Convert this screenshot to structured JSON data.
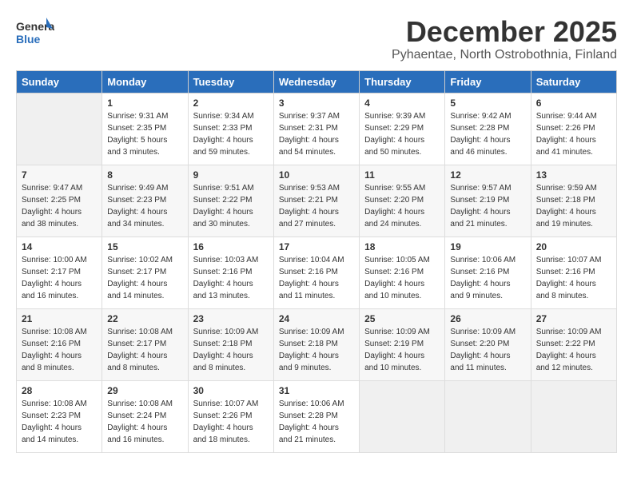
{
  "header": {
    "logo_general": "General",
    "logo_blue": "Blue",
    "month_title": "December 2025",
    "location": "Pyhaentae, North Ostrobothnia, Finland"
  },
  "days_of_week": [
    "Sunday",
    "Monday",
    "Tuesday",
    "Wednesday",
    "Thursday",
    "Friday",
    "Saturday"
  ],
  "weeks": [
    [
      {
        "day": "",
        "info": ""
      },
      {
        "day": "1",
        "info": "Sunrise: 9:31 AM\nSunset: 2:35 PM\nDaylight: 5 hours\nand 3 minutes."
      },
      {
        "day": "2",
        "info": "Sunrise: 9:34 AM\nSunset: 2:33 PM\nDaylight: 4 hours\nand 59 minutes."
      },
      {
        "day": "3",
        "info": "Sunrise: 9:37 AM\nSunset: 2:31 PM\nDaylight: 4 hours\nand 54 minutes."
      },
      {
        "day": "4",
        "info": "Sunrise: 9:39 AM\nSunset: 2:29 PM\nDaylight: 4 hours\nand 50 minutes."
      },
      {
        "day": "5",
        "info": "Sunrise: 9:42 AM\nSunset: 2:28 PM\nDaylight: 4 hours\nand 46 minutes."
      },
      {
        "day": "6",
        "info": "Sunrise: 9:44 AM\nSunset: 2:26 PM\nDaylight: 4 hours\nand 41 minutes."
      }
    ],
    [
      {
        "day": "7",
        "info": "Sunrise: 9:47 AM\nSunset: 2:25 PM\nDaylight: 4 hours\nand 38 minutes."
      },
      {
        "day": "8",
        "info": "Sunrise: 9:49 AM\nSunset: 2:23 PM\nDaylight: 4 hours\nand 34 minutes."
      },
      {
        "day": "9",
        "info": "Sunrise: 9:51 AM\nSunset: 2:22 PM\nDaylight: 4 hours\nand 30 minutes."
      },
      {
        "day": "10",
        "info": "Sunrise: 9:53 AM\nSunset: 2:21 PM\nDaylight: 4 hours\nand 27 minutes."
      },
      {
        "day": "11",
        "info": "Sunrise: 9:55 AM\nSunset: 2:20 PM\nDaylight: 4 hours\nand 24 minutes."
      },
      {
        "day": "12",
        "info": "Sunrise: 9:57 AM\nSunset: 2:19 PM\nDaylight: 4 hours\nand 21 minutes."
      },
      {
        "day": "13",
        "info": "Sunrise: 9:59 AM\nSunset: 2:18 PM\nDaylight: 4 hours\nand 19 minutes."
      }
    ],
    [
      {
        "day": "14",
        "info": "Sunrise: 10:00 AM\nSunset: 2:17 PM\nDaylight: 4 hours\nand 16 minutes."
      },
      {
        "day": "15",
        "info": "Sunrise: 10:02 AM\nSunset: 2:17 PM\nDaylight: 4 hours\nand 14 minutes."
      },
      {
        "day": "16",
        "info": "Sunrise: 10:03 AM\nSunset: 2:16 PM\nDaylight: 4 hours\nand 13 minutes."
      },
      {
        "day": "17",
        "info": "Sunrise: 10:04 AM\nSunset: 2:16 PM\nDaylight: 4 hours\nand 11 minutes."
      },
      {
        "day": "18",
        "info": "Sunrise: 10:05 AM\nSunset: 2:16 PM\nDaylight: 4 hours\nand 10 minutes."
      },
      {
        "day": "19",
        "info": "Sunrise: 10:06 AM\nSunset: 2:16 PM\nDaylight: 4 hours\nand 9 minutes."
      },
      {
        "day": "20",
        "info": "Sunrise: 10:07 AM\nSunset: 2:16 PM\nDaylight: 4 hours\nand 8 minutes."
      }
    ],
    [
      {
        "day": "21",
        "info": "Sunrise: 10:08 AM\nSunset: 2:16 PM\nDaylight: 4 hours\nand 8 minutes."
      },
      {
        "day": "22",
        "info": "Sunrise: 10:08 AM\nSunset: 2:17 PM\nDaylight: 4 hours\nand 8 minutes."
      },
      {
        "day": "23",
        "info": "Sunrise: 10:09 AM\nSunset: 2:18 PM\nDaylight: 4 hours\nand 8 minutes."
      },
      {
        "day": "24",
        "info": "Sunrise: 10:09 AM\nSunset: 2:18 PM\nDaylight: 4 hours\nand 9 minutes."
      },
      {
        "day": "25",
        "info": "Sunrise: 10:09 AM\nSunset: 2:19 PM\nDaylight: 4 hours\nand 10 minutes."
      },
      {
        "day": "26",
        "info": "Sunrise: 10:09 AM\nSunset: 2:20 PM\nDaylight: 4 hours\nand 11 minutes."
      },
      {
        "day": "27",
        "info": "Sunrise: 10:09 AM\nSunset: 2:22 PM\nDaylight: 4 hours\nand 12 minutes."
      }
    ],
    [
      {
        "day": "28",
        "info": "Sunrise: 10:08 AM\nSunset: 2:23 PM\nDaylight: 4 hours\nand 14 minutes."
      },
      {
        "day": "29",
        "info": "Sunrise: 10:08 AM\nSunset: 2:24 PM\nDaylight: 4 hours\nand 16 minutes."
      },
      {
        "day": "30",
        "info": "Sunrise: 10:07 AM\nSunset: 2:26 PM\nDaylight: 4 hours\nand 18 minutes."
      },
      {
        "day": "31",
        "info": "Sunrise: 10:06 AM\nSunset: 2:28 PM\nDaylight: 4 hours\nand 21 minutes."
      },
      {
        "day": "",
        "info": ""
      },
      {
        "day": "",
        "info": ""
      },
      {
        "day": "",
        "info": ""
      }
    ]
  ]
}
